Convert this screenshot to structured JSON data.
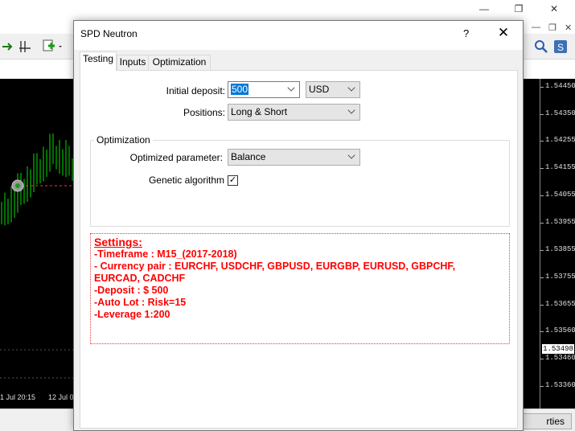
{
  "window_controls": [
    "—",
    "❐",
    "✕"
  ],
  "inner_window_controls": [
    "—",
    "❐",
    "✕"
  ],
  "dialog": {
    "title": "SPD Neutron",
    "help": "?",
    "close": "✕",
    "tabs": [
      {
        "label": "Testing",
        "active": true
      },
      {
        "label": "Inputs",
        "active": false
      },
      {
        "label": "Optimization",
        "active": false
      }
    ],
    "fields": {
      "initial_deposit_label": "Initial deposit:",
      "initial_deposit_value": "500",
      "currency_value": "USD",
      "positions_label": "Positions:",
      "positions_value": "Long & Short"
    },
    "optimization": {
      "group_label": "Optimization",
      "parameter_label": "Optimized parameter:",
      "parameter_value": "Balance",
      "genetic_label": "Genetic algorithm",
      "genetic_checked": "✓"
    },
    "notes": {
      "heading": "Settings:",
      "lines": [
        "-Timeframe : M15_(2017-2018)",
        "- Currency pair : EURCHF, USDCHF, GBPUSD, EURGBP, EURUSD, GBPCHF,",
        "EURCAD, CADCHF",
        "-Deposit : $ 500",
        "-Auto Lot : Risk=15",
        "-Leverage 1:200"
      ],
      "color": "#ff0000"
    }
  },
  "chart": {
    "price_labels": [
      "1.54450",
      "1.54350",
      "1.54255",
      "1.54155",
      "1.54055",
      "1.53955",
      "1.53855",
      "1.53755",
      "1.53655",
      "1.53560",
      "1.53460",
      "1.53360"
    ],
    "current_price": "1.53498",
    "time_labels": [
      "1 Jul 20:15",
      "12 Jul 0"
    ],
    "candle_color": "#00e000",
    "background": "#000000"
  },
  "statusbar": {
    "button_label": "rties"
  }
}
